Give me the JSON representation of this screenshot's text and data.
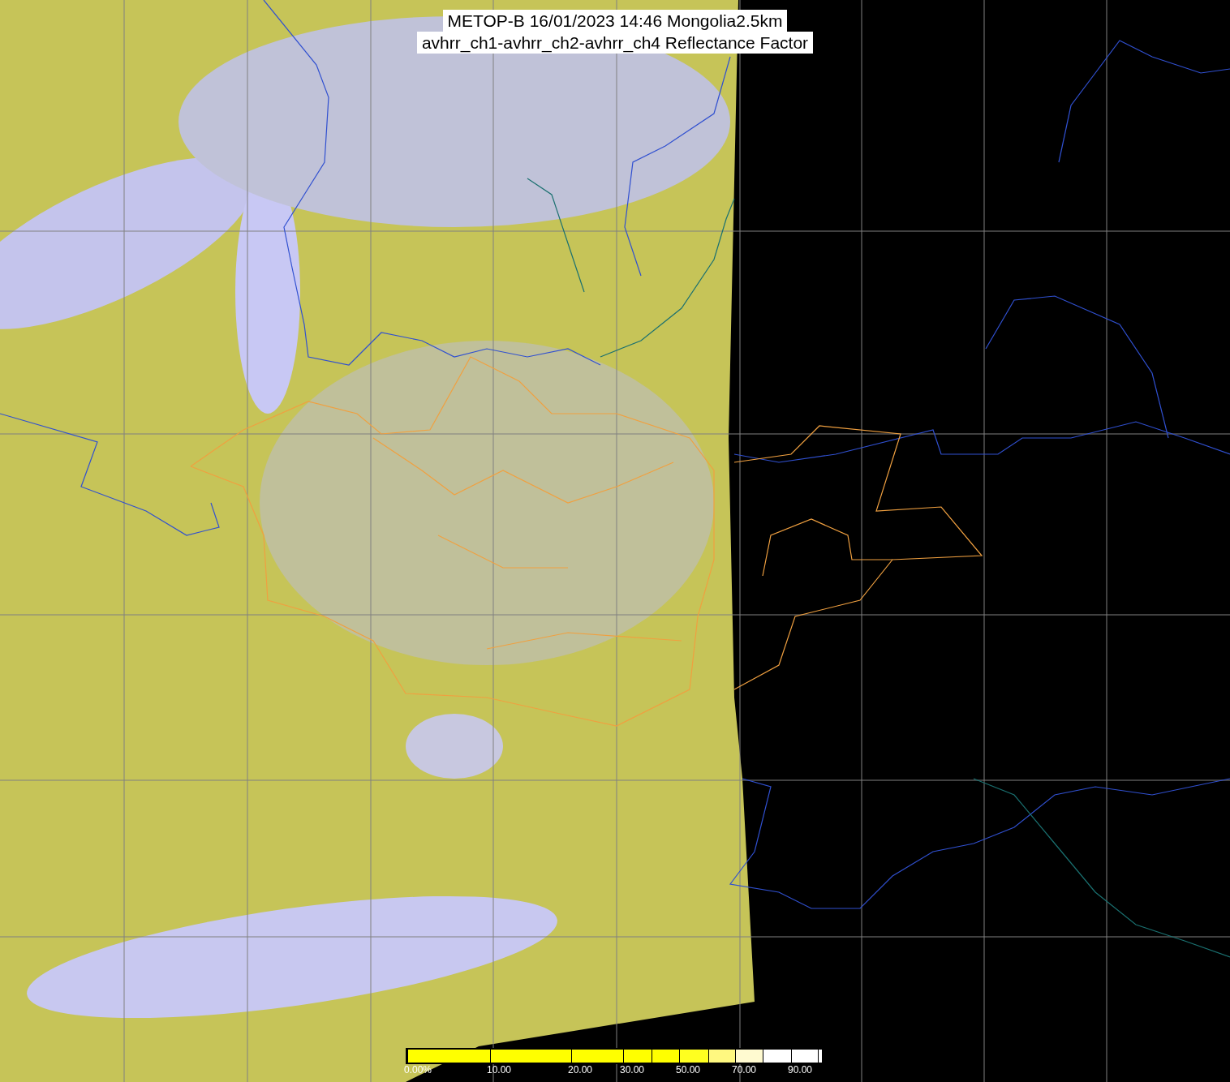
{
  "title": {
    "lines": [
      "METOP-B 16/01/2023 14:46 Mongolia2.5km",
      "avhrr_ch1-avhrr_ch2-avhrr_ch4 Reflectance Factor"
    ]
  },
  "colorbar": {
    "segments": [
      {
        "color": "#ffff00",
        "label": "0.00%"
      },
      {
        "color": "#ffff00",
        "label": "10.00"
      },
      {
        "color": "#ffff00",
        "label": "20.00"
      },
      {
        "color": "#ffff00",
        "label": "30.00"
      },
      {
        "color": "#ffff00"
      },
      {
        "color": "#ffff20",
        "label": "50.00"
      },
      {
        "color": "#fff880"
      },
      {
        "color": "#fffad0",
        "label": "70.00"
      },
      {
        "color": "#ffffff"
      },
      {
        "color": "#ffffff",
        "label": "90.00"
      },
      {
        "color": "#ffffff"
      }
    ]
  }
}
